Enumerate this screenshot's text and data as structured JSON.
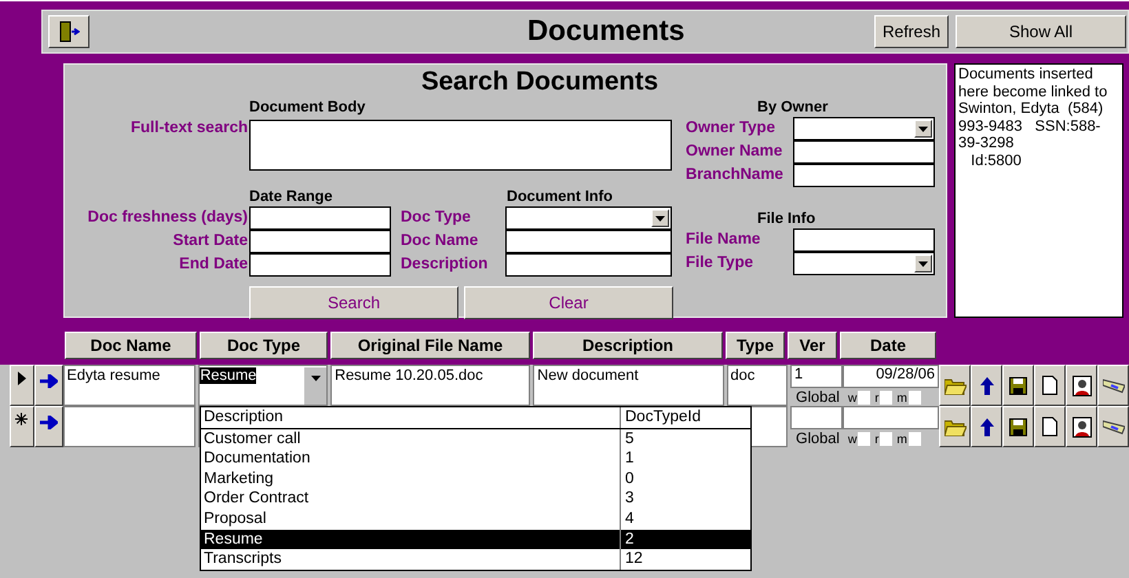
{
  "window": {
    "title": "Documents"
  },
  "toolbar": {
    "buttons": [
      "Refresh",
      "Show All"
    ]
  },
  "search": {
    "title": "Search Documents",
    "body": {
      "heading": "Document Body",
      "label": "Full-text search"
    },
    "owner": {
      "heading": "By Owner",
      "fields": [
        {
          "label": "Owner Type",
          "kind": "combo"
        },
        {
          "label": "Owner Name",
          "kind": "text"
        },
        {
          "label": "BranchName",
          "kind": "text"
        }
      ]
    },
    "date_range": {
      "heading": "Date Range",
      "fields": [
        {
          "label": "Doc freshness (days)",
          "kind": "text"
        },
        {
          "label": "Start Date",
          "kind": "text"
        },
        {
          "label": "End Date",
          "kind": "text"
        }
      ]
    },
    "document_info": {
      "heading": "Document Info",
      "fields": [
        {
          "label": "Doc Type",
          "kind": "combo"
        },
        {
          "label": "Doc Name",
          "kind": "text"
        },
        {
          "label": "Description",
          "kind": "text"
        }
      ]
    },
    "file_info": {
      "heading": "File Info",
      "fields": [
        {
          "label": "File Name",
          "kind": "text"
        },
        {
          "label": "File Type",
          "kind": "combo"
        }
      ]
    },
    "buttons": [
      "Search",
      "Clear"
    ]
  },
  "note": "Documents inserted here become linked to Swinton, Edyta  (584) 993-9483   SSN:588-39-3298\n   Id:5800",
  "grid": {
    "columns": [
      "Doc Name",
      "Doc Type",
      "Original File Name",
      "Description",
      "Type",
      "Ver",
      "Date"
    ],
    "rows": [
      {
        "kind": "current",
        "doc_name": "Edyta resume",
        "doc_type": "Resume",
        "original_file_name": "Resume 10.20.05.doc",
        "description": "New document",
        "type": "doc",
        "ver": "1",
        "date": "09/28/06",
        "global_label": "Global",
        "flags": [
          {
            "label": "w",
            "checked": false
          },
          {
            "label": "r",
            "checked": false
          },
          {
            "label": "m",
            "checked": false
          }
        ]
      },
      {
        "kind": "new",
        "global_label": "Global",
        "flags": [
          {
            "label": "w",
            "checked": false
          },
          {
            "label": "r",
            "checked": false
          },
          {
            "label": "m",
            "checked": false
          }
        ]
      }
    ]
  },
  "dropdown": {
    "columns": [
      "Description",
      "DocTypeId"
    ],
    "items": [
      {
        "description": "Customer call",
        "id": "5",
        "selected": false
      },
      {
        "description": "Documentation",
        "id": "1",
        "selected": false
      },
      {
        "description": "Marketing",
        "id": "0",
        "selected": false
      },
      {
        "description": "Order Contract",
        "id": "3",
        "selected": false
      },
      {
        "description": "Proposal",
        "id": "4",
        "selected": false
      },
      {
        "description": "Resume",
        "id": "2",
        "selected": true
      },
      {
        "description": "Transcripts",
        "id": "12",
        "selected": false
      }
    ]
  }
}
